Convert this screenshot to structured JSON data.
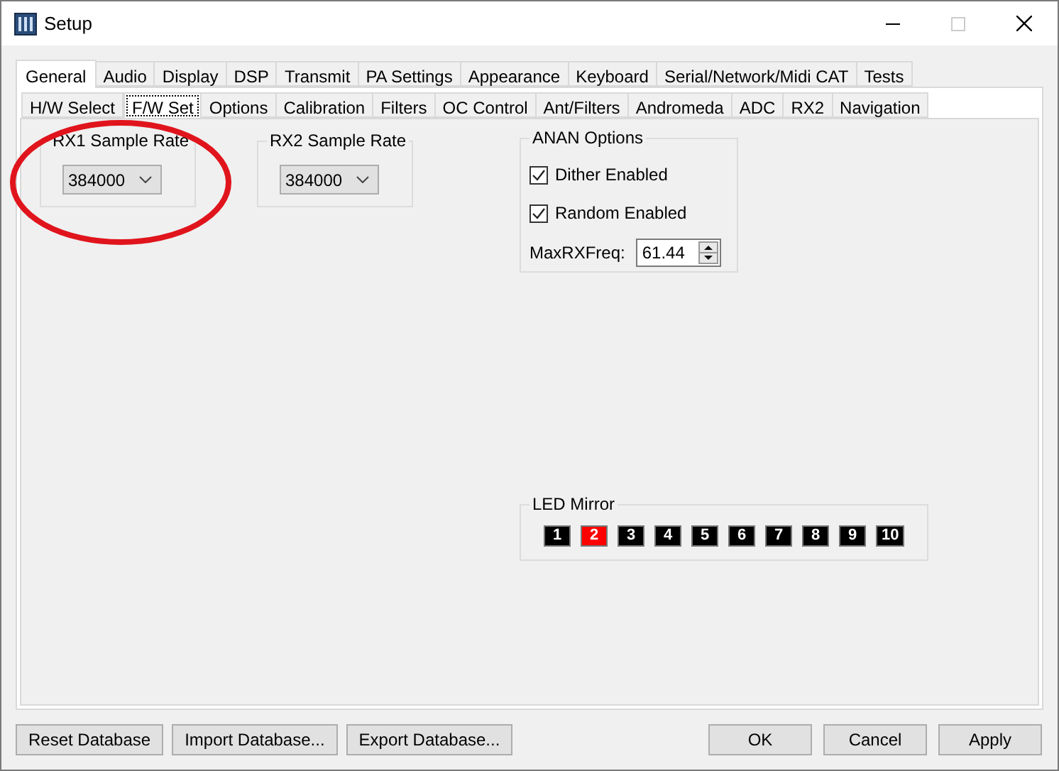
{
  "window": {
    "title": "Setup"
  },
  "tabs": [
    {
      "label": "General",
      "selected": true
    },
    {
      "label": "Audio",
      "selected": false
    },
    {
      "label": "Display",
      "selected": false
    },
    {
      "label": "DSP",
      "selected": false
    },
    {
      "label": "Transmit",
      "selected": false
    },
    {
      "label": "PA Settings",
      "selected": false
    },
    {
      "label": "Appearance",
      "selected": false
    },
    {
      "label": "Keyboard",
      "selected": false
    },
    {
      "label": "Serial/Network/Midi CAT",
      "selected": false
    },
    {
      "label": "Tests",
      "selected": false
    }
  ],
  "subtabs": [
    {
      "label": "H/W Select",
      "selected": false
    },
    {
      "label": "F/W Set",
      "selected": true
    },
    {
      "label": "Options",
      "selected": false
    },
    {
      "label": "Calibration",
      "selected": false
    },
    {
      "label": "Filters",
      "selected": false
    },
    {
      "label": "OC Control",
      "selected": false
    },
    {
      "label": "Ant/Filters",
      "selected": false
    },
    {
      "label": "Andromeda",
      "selected": false
    },
    {
      "label": "ADC",
      "selected": false
    },
    {
      "label": "RX2",
      "selected": false
    },
    {
      "label": "Navigation",
      "selected": false
    }
  ],
  "rx1_sample_rate": {
    "title": "RX1 Sample Rate",
    "value": "384000"
  },
  "rx2_sample_rate": {
    "title": "RX2 Sample Rate",
    "value": "384000"
  },
  "anan_options": {
    "title": "ANAN Options",
    "checkboxes": [
      {
        "label": "Dither Enabled",
        "checked": true
      },
      {
        "label": "Random Enabled",
        "checked": true
      }
    ],
    "max_rx_freq": {
      "label": "MaxRXFreq:",
      "value": "61.44"
    }
  },
  "led_mirror": {
    "title": "LED Mirror",
    "leds": [
      {
        "label": "1",
        "on": false
      },
      {
        "label": "2",
        "on": true
      },
      {
        "label": "3",
        "on": false
      },
      {
        "label": "4",
        "on": false
      },
      {
        "label": "5",
        "on": false
      },
      {
        "label": "6",
        "on": false
      },
      {
        "label": "7",
        "on": false
      },
      {
        "label": "8",
        "on": false
      },
      {
        "label": "9",
        "on": false
      },
      {
        "label": "10",
        "on": false
      }
    ]
  },
  "left_buttons": [
    "Reset Database",
    "Import Database...",
    "Export Database..."
  ],
  "right_buttons": [
    "OK",
    "Cancel",
    "Apply"
  ]
}
